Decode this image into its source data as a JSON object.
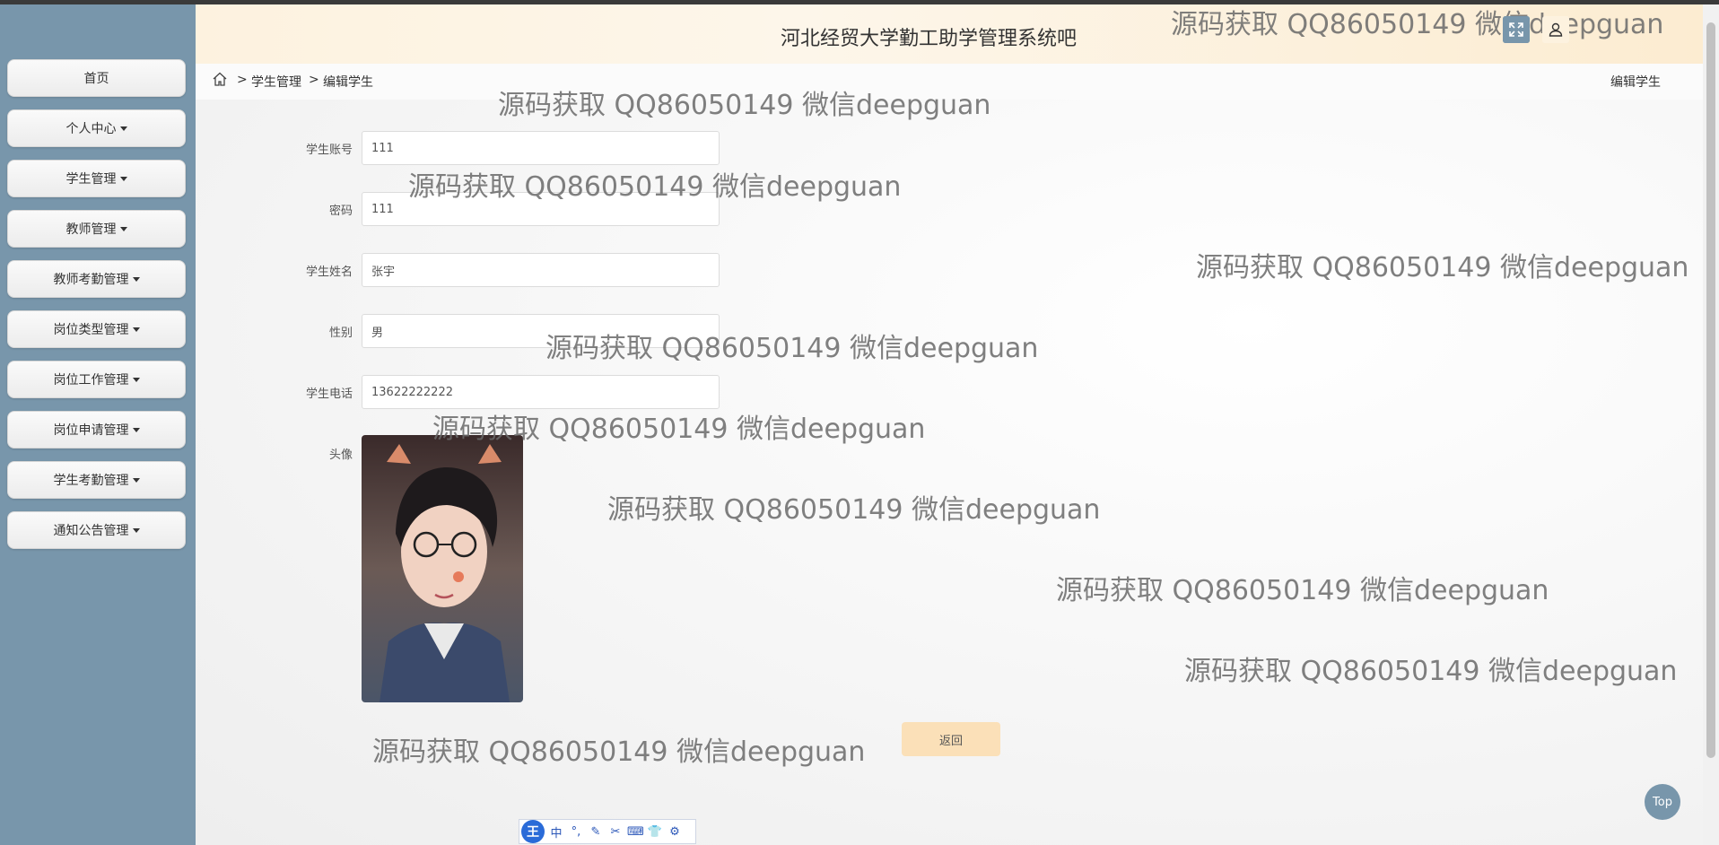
{
  "header": {
    "title": "河北经贸大学勤工助学管理系统吧"
  },
  "breadcrumb": {
    "home_icon": "home-icon",
    "sep1": ">",
    "item1": "学生管理",
    "sep2": ">",
    "item2": "编辑学生",
    "right_title": "编辑学生"
  },
  "sidebar": {
    "items": [
      {
        "label": "首页",
        "dropdown": false
      },
      {
        "label": "个人中心",
        "dropdown": true
      },
      {
        "label": "学生管理",
        "dropdown": true
      },
      {
        "label": "教师管理",
        "dropdown": true
      },
      {
        "label": "教师考勤管理",
        "dropdown": true
      },
      {
        "label": "岗位类型管理",
        "dropdown": true
      },
      {
        "label": "岗位工作管理",
        "dropdown": true
      },
      {
        "label": "岗位申请管理",
        "dropdown": true
      },
      {
        "label": "学生考勤管理",
        "dropdown": true
      },
      {
        "label": "通知公告管理",
        "dropdown": true
      }
    ]
  },
  "form": {
    "account": {
      "label": "学生账号",
      "value": "111"
    },
    "password": {
      "label": "密码",
      "value": "111"
    },
    "name": {
      "label": "学生姓名",
      "value": "张宇"
    },
    "gender": {
      "label": "性别",
      "value": "男"
    },
    "phone": {
      "label": "学生电话",
      "value": "13622222222"
    },
    "avatar": {
      "label": "头像"
    },
    "back_label": "返回"
  },
  "watermark": "源码获取 QQ86050149 微信deepguan",
  "top_button": "Top",
  "ime_toolbar": {
    "logo": "王",
    "items": [
      "中",
      "°,",
      "✎",
      "✂",
      "⌨",
      "👕",
      "⚙"
    ]
  },
  "colors": {
    "sidebar": "#7896ab",
    "header_gradient_start": "#fdf2df",
    "back_button": "#fbe0b8"
  }
}
